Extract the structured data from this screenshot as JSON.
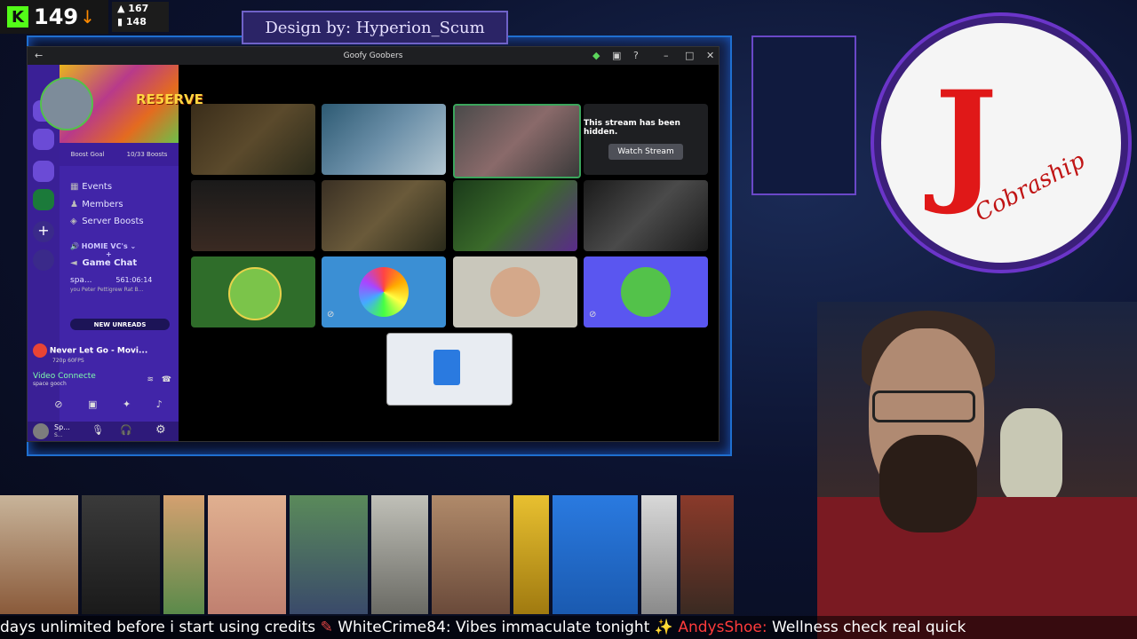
{
  "overlay": {
    "kick_count": "149",
    "stat_up": "167",
    "stat_down": "148",
    "design_credit": "Design by: Hyperion_Scum"
  },
  "discord": {
    "window_title": "Goofy Goobers",
    "server_banner_text": "RE5ERVE",
    "boost_goal": "Boost Goal",
    "boost_progress": "10/33 Boosts",
    "channels": [
      {
        "label": "Events",
        "icon": "calendar-icon"
      },
      {
        "label": "Members",
        "icon": "members-icon"
      },
      {
        "label": "Server Boosts",
        "icon": "boost-icon"
      }
    ],
    "category": "HOMIE VC's",
    "voice_channel": "Game Chat",
    "voice_user": "spa...",
    "voice_user_time": "561:06:14",
    "voice_user_status": "you Peter Pettigrew Rat B...",
    "new_unreads": "NEW UNREADS",
    "activity_title": "Never Let Go - Movi...",
    "activity_sub": "720p 60FPS",
    "connection_title": "Video Connecte",
    "connection_sub": "space gooch",
    "user_name": "Sp...",
    "user_status": "S...",
    "hidden_stream_text": "This stream has been hidden.",
    "watch_stream_label": "Watch Stream"
  },
  "logo": {
    "letter": "J",
    "script": "Cobraship"
  },
  "ticker": {
    "part1": "days unlimited before i start using credits",
    "user1": "WhiteCrime84:",
    "msg1": "Vibes immaculate tonight ✨",
    "user2": "AndysShoe:",
    "msg2": "Wellness check real quick"
  },
  "colors": {
    "kick_green": "#53fc18",
    "discord_purple": "#4125a8",
    "accent_blue": "#1f6fd0",
    "logo_red": "#e01818"
  }
}
